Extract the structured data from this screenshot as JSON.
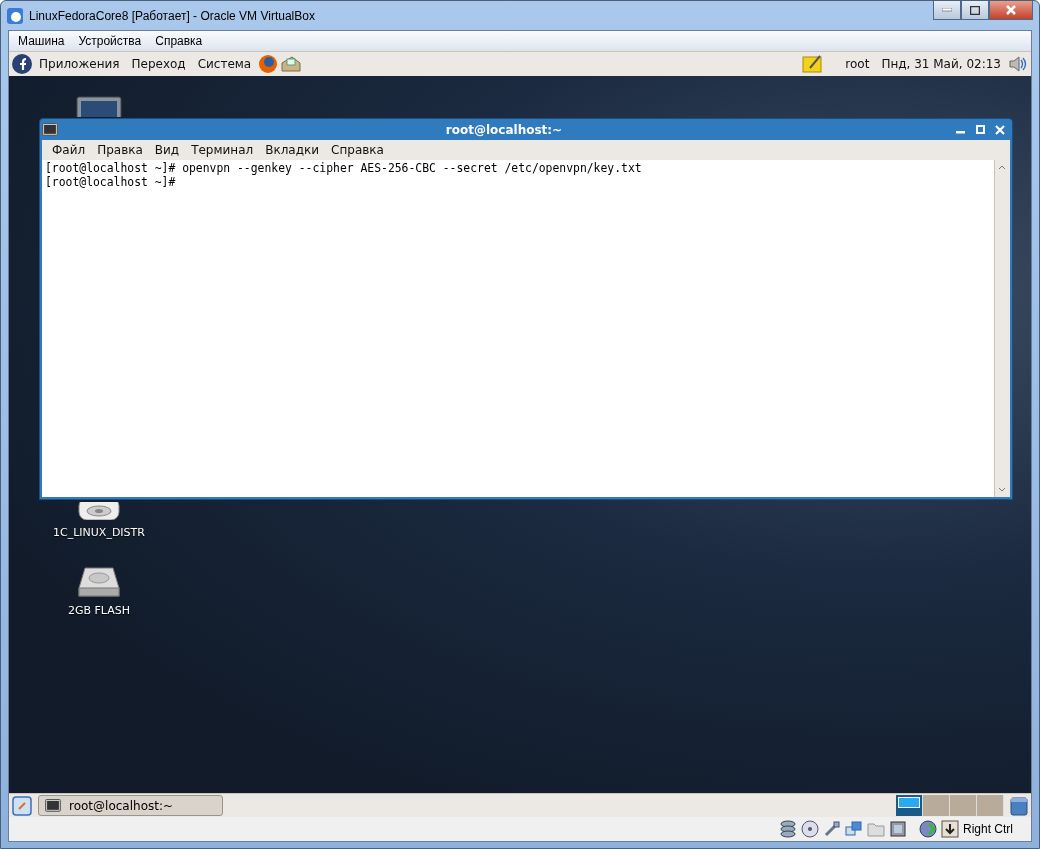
{
  "window": {
    "title": "LinuxFedoraCore8 [Работает] - Oracle VM VirtualBox"
  },
  "menu": [
    "Машина",
    "Устройства",
    "Справка"
  ],
  "top_panel": {
    "menus": [
      "Приложения",
      "Переход",
      "Система"
    ],
    "user": "root",
    "clock": "Пнд, 31 Май, 02:13"
  },
  "desktop_icons": [
    {
      "kind": "computer"
    },
    {
      "kind": "cdrom",
      "label": "1C_LINUX_DISTR"
    },
    {
      "kind": "drive",
      "label": "2GB FLASH"
    }
  ],
  "terminal": {
    "title": "root@localhost:~",
    "menu": [
      "Файл",
      "Правка",
      "Вид",
      "Терминал",
      "Вкладки",
      "Справка"
    ],
    "lines": [
      "[root@localhost ~]# openvpn --genkey --cipher AES-256-CBC --secret /etc/openvpn/key.txt",
      "[root@localhost ~]#"
    ]
  },
  "taskbar": {
    "tasks": [
      {
        "label": "root@localhost:~"
      }
    ],
    "workspaces": [
      {
        "selected": true
      },
      {
        "selected": false
      },
      {
        "selected": false
      },
      {
        "selected": false
      }
    ]
  },
  "status_bar": {
    "host_key": "Right Ctrl"
  }
}
